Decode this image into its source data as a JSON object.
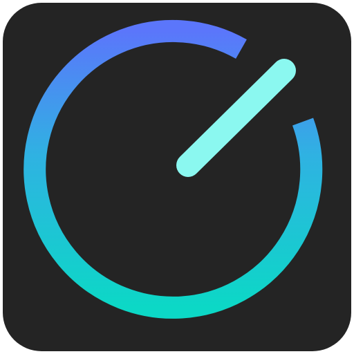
{
  "app_icon": {
    "icon_name": "timer-dial-icon",
    "colors": {
      "background": "#242424",
      "ring_gradient_top": "#5B76FB",
      "ring_gradient_mid": "#2FB2E2",
      "ring_gradient_bottom": "#0CD8C6",
      "needle": "#8BF8F0"
    }
  }
}
